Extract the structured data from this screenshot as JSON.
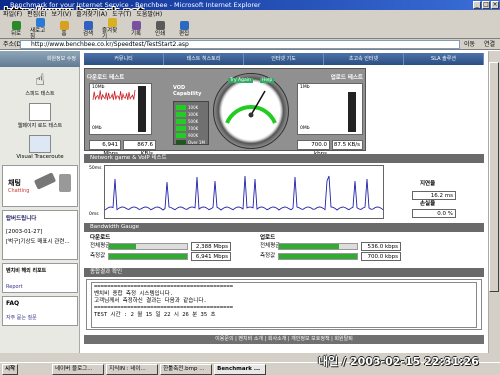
{
  "window": {
    "title": "Benchmark for your Internet Service - Benchbee - Microsoft Internet Explorer",
    "watermark": "http://www.bcpark.net"
  },
  "menu": {
    "items": [
      "파일(F)",
      "편집(E)",
      "보기(V)",
      "즐겨찾기(A)",
      "도구(T)",
      "도움말(H)"
    ]
  },
  "toolbar": {
    "buttons": [
      "뒤로",
      "새로고침",
      "홈",
      "검색",
      "즐겨찾기",
      "기록",
      "인쇄",
      "편집"
    ]
  },
  "address": {
    "label": "주소(D)",
    "url": "http://www.benchbee.co.kr/Speedtest/TestStart2.asp",
    "go": "이동",
    "links": "연결"
  },
  "sidebar": {
    "header": "회원정보 수정",
    "nav": [
      "스피드 테스트",
      "웹페이지 로드 테스트",
      "Visual Traceroute"
    ],
    "promo": {
      "title": "채팅",
      "sub": "Chatting"
    },
    "news": {
      "title": "탑버드립니다",
      "date": "[2003-01-27]",
      "body": "[벅구]기상도 매표시 관련..."
    },
    "report": {
      "title": "벤치비 해외 리포트",
      "link": "Report"
    },
    "faq": {
      "title": "FAQ",
      "link": "자주 묻는 질문"
    }
  },
  "tabs": [
    "커뮤니티",
    "테스트 히스토리",
    "인터넷 기도",
    "초고속 인터넷",
    "SLA 솔루션"
  ],
  "download": {
    "title": "다운로드 테스트",
    "max": "10Mb",
    "min": "0Mb",
    "mbps": "6,941 Mbps",
    "kbs": "867.6 KB/s"
  },
  "vod": {
    "title": "VOD Capability",
    "levels": [
      "100K",
      "300K",
      "500K",
      "700K",
      "900K",
      "Over 1M"
    ],
    "retry": "Try Again",
    "help": "Help"
  },
  "upload": {
    "title": "업로드 테스트",
    "max": "1Mb",
    "min": "0Mb",
    "kbps": "700.0 kbps",
    "kbs": "87.5 KB/s"
  },
  "game": {
    "title": "Network game & VoIP 테스트",
    "max": "50ms",
    "min": "0ms",
    "latency_label": "지연율",
    "latency": "16.2 ms",
    "loss_label": "손실율",
    "loss": "0.0 %"
  },
  "bandwidth": {
    "title": "Bandwidth Gauge",
    "down": {
      "label": "다운로드",
      "rows": [
        {
          "name": "전체평균",
          "value": "2,388 Mbps",
          "fill": 0.34
        },
        {
          "name": "측정값",
          "value": "6,941 Mbps",
          "fill": 1.0
        }
      ]
    },
    "up": {
      "label": "업로드",
      "rows": [
        {
          "name": "전체평균",
          "value": "536.0 kbps",
          "fill": 0.77
        },
        {
          "name": "측정값",
          "value": "700.0 kbps",
          "fill": 1.0
        }
      ]
    }
  },
  "results": {
    "title": "종합결과 확인",
    "lines": [
      "==========================================",
      "벤치비 종합 측정 시스템입니다.",
      "고객님께서 측정하신 결과는 다음과 같습니다.",
      "==========================================",
      "TEST 시간 :        2 월 15 일  22 시 26 분 35 초"
    ]
  },
  "footer": "이용문의 | 벤치비 소개 | 회사소개 | 개인정보 보호정책 | 회원탈퇴",
  "taskbar": {
    "start": "시작",
    "items": [
      "네이버 블로그...",
      "지식IN : 네이...",
      "한툴축전.bmp ...",
      "Benchmark ..."
    ]
  },
  "stamp": "내일 / 2003-02-15 22:31:26",
  "colors": {
    "title_bar": "#0a2a8a",
    "nav_bar": "#3a5d95",
    "panel": "#909090",
    "graph_line": "#2222aa",
    "bar": "#33aa33",
    "gauge_green": "#22cc22"
  }
}
